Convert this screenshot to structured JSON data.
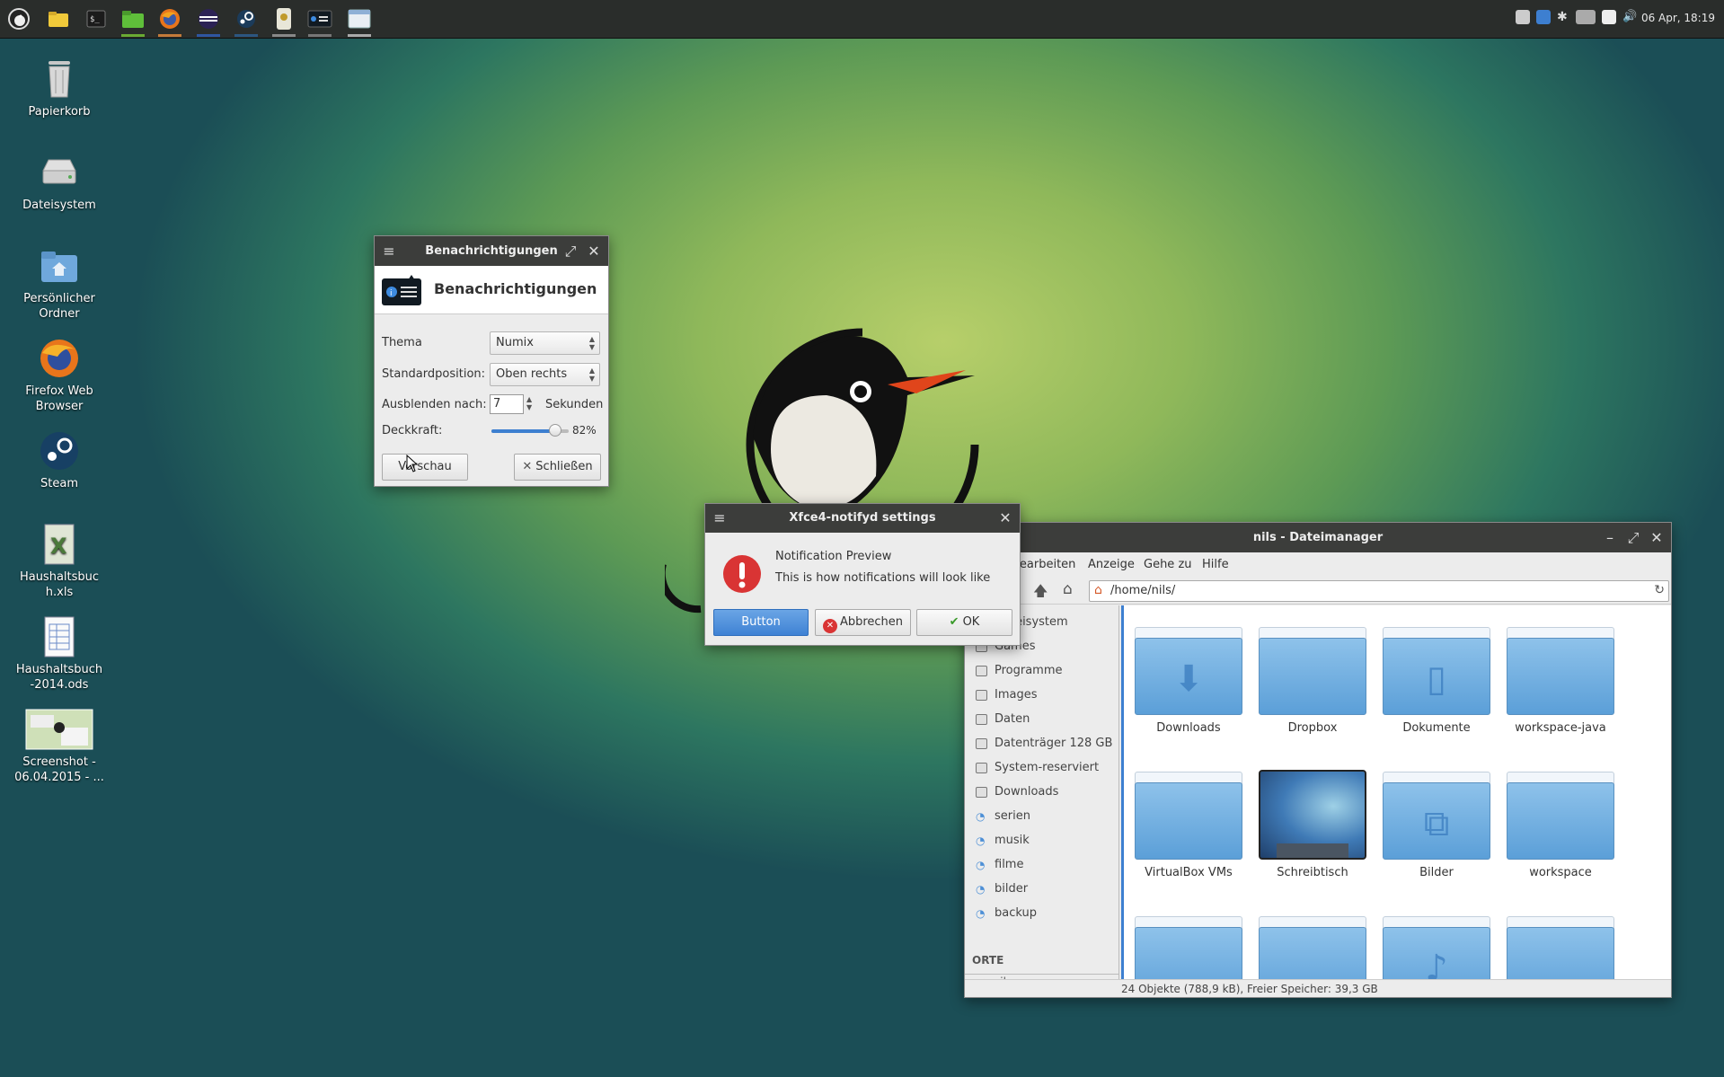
{
  "clock": "06 Apr, 18:19",
  "desktop_icons": [
    {
      "name": "trash-icon",
      "label": "Papierkorb"
    },
    {
      "name": "filesystem-icon",
      "label": "Dateisystem"
    },
    {
      "name": "home-folder-icon",
      "label": "Persönlicher\nOrdner"
    },
    {
      "name": "firefox-icon",
      "label": "Firefox Web\nBrowser"
    },
    {
      "name": "steam-icon",
      "label": "Steam"
    },
    {
      "name": "xls-file-icon",
      "label": "Haushaltsbuc\nh.xls"
    },
    {
      "name": "ods-file-icon",
      "label": "Haushaltsbuch\n-2014.ods"
    },
    {
      "name": "screenshot-file-icon",
      "label": "Screenshot -\n06.04.2015 - ..."
    }
  ],
  "notif_win": {
    "title": "Benachrichtigungen",
    "heading": "Benachrichtigungen",
    "thema_label": "Thema",
    "thema_value": "Numix",
    "position_label": "Standardposition:",
    "position_value": "Oben rechts",
    "hide_label": "Ausblenden nach:",
    "hide_value": "7",
    "hide_unit": "Sekunden",
    "opacity_label": "Deckkraft:",
    "opacity_value": "82%",
    "opacity_fraction": 0.82,
    "preview_btn": "Vorschau",
    "close_btn": "Schließen"
  },
  "preview": {
    "title": "Xfce4-notifyd settings",
    "heading": "Notification Preview",
    "body": "This is how notifications will look like",
    "btn_button": "Button",
    "btn_cancel": "Abbrechen",
    "btn_ok": "OK"
  },
  "fm": {
    "title": "nils - Dateimanager",
    "menu": [
      "Bearbeiten",
      "Anzeige",
      "Gehe zu",
      "Hilfe"
    ],
    "path": "/home/nils/",
    "sidebar": [
      {
        "label": "Dateisystem",
        "kind": "drive"
      },
      {
        "label": "Games",
        "kind": "drive"
      },
      {
        "label": "Programme",
        "kind": "drive"
      },
      {
        "label": "Images",
        "kind": "drive"
      },
      {
        "label": "Daten",
        "kind": "drive"
      },
      {
        "label": "Datenträger 128 GB",
        "kind": "drive"
      },
      {
        "label": "System-reserviert",
        "kind": "drive"
      },
      {
        "label": "Downloads",
        "kind": "drive"
      },
      {
        "label": "serien",
        "kind": "net"
      },
      {
        "label": "musik",
        "kind": "net"
      },
      {
        "label": "filme",
        "kind": "net"
      },
      {
        "label": "bilder",
        "kind": "net"
      },
      {
        "label": "backup",
        "kind": "net"
      }
    ],
    "places_header": "ORTE",
    "places_first": "nils",
    "folders": [
      "Downloads",
      "Dropbox",
      "Dokumente",
      "workspace-java",
      "VirtualBox VMs",
      "Schreibtisch",
      "Bilder",
      "workspace"
    ],
    "status": "24 Objekte (788,9 kB), Freier Speicher: 39,3 GB"
  }
}
